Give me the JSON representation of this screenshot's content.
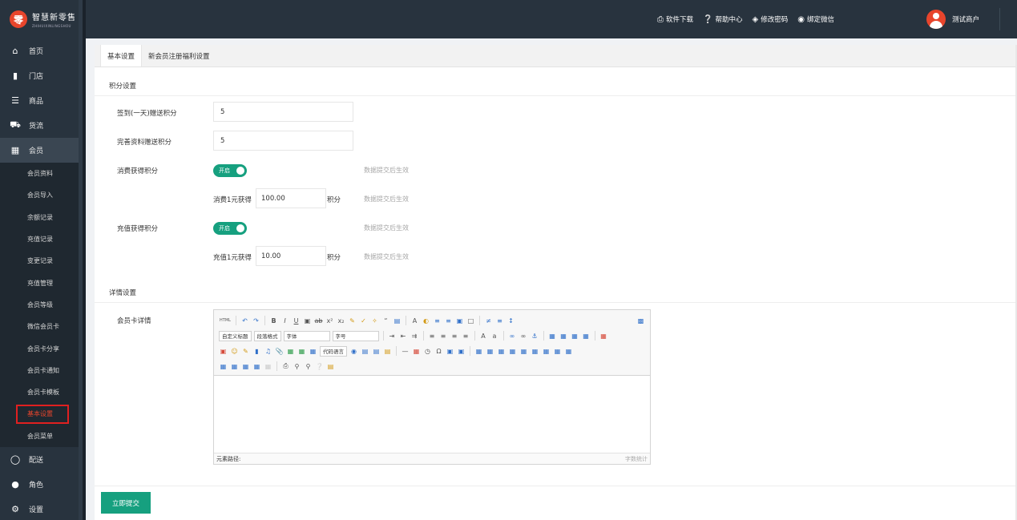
{
  "app": {
    "name": "智慧新零售",
    "subtitle": "ZHIHUIXINLINGSHOU",
    "logo_char": "零"
  },
  "topbar": {
    "links": [
      {
        "icon": "print-icon",
        "label": "软件下载"
      },
      {
        "icon": "help-icon",
        "label": "帮助中心"
      },
      {
        "icon": "thermometer-icon",
        "label": "修改密码"
      },
      {
        "icon": "wechat-icon",
        "label": "绑定微信"
      }
    ],
    "user_name": "测试商户"
  },
  "sidebar": {
    "items": [
      {
        "label": "首页",
        "icon": "home-icon"
      },
      {
        "label": "门店",
        "icon": "store-icon"
      },
      {
        "label": "商品",
        "icon": "list-icon"
      },
      {
        "label": "货流",
        "icon": "truck-icon"
      },
      {
        "label": "会员",
        "icon": "member-card-icon"
      }
    ],
    "member_sub": [
      "会员资料",
      "会员导入",
      "余额记录",
      "充值记录",
      "变更记录",
      "充值管理",
      "会员等级",
      "微信会员卡",
      "会员卡分享",
      "会员卡通知",
      "会员卡模板",
      "基本设置",
      "会员菜单"
    ],
    "bottom_items": [
      {
        "label": "配送",
        "icon": "bike-icon"
      },
      {
        "label": "角色",
        "icon": "user-circle-icon"
      },
      {
        "label": "设置",
        "icon": "gear-icon"
      }
    ]
  },
  "tabs": [
    "基本设置",
    "新会员注册福利设置"
  ],
  "points": {
    "section_title": "积分设置",
    "checkin_label": "签到(一天)赠送积分",
    "checkin_value": "5",
    "profile_label": "完善资料赠送积分",
    "profile_value": "5",
    "consume_label": "消费获得积分",
    "consume_toggle": "开启",
    "consume_hint": "数据提交后生效",
    "consume_rate_label": "消费1元获得",
    "consume_rate_value": "100.00",
    "consume_unit": "积分",
    "consume_rate_hint": "数据提交后生效",
    "recharge_label": "充值获得积分",
    "recharge_toggle": "开启",
    "recharge_hint": "数据提交后生效",
    "recharge_rate_label": "充值1元获得",
    "recharge_rate_value": "10.00",
    "recharge_unit": "积分",
    "recharge_rate_hint": "数据提交后生效"
  },
  "detail": {
    "section_title": "详情设置",
    "card_label": "会员卡详情",
    "toolbar": {
      "html_label": "HTML",
      "heading_select": "自定义标题",
      "paragraph_select": "段落格式",
      "font_select": "字体",
      "size_select": "字号",
      "code_select": "代码语言"
    },
    "path_label": "元素路径:",
    "word_count": "字数统计"
  },
  "submit_label": "立即提交"
}
